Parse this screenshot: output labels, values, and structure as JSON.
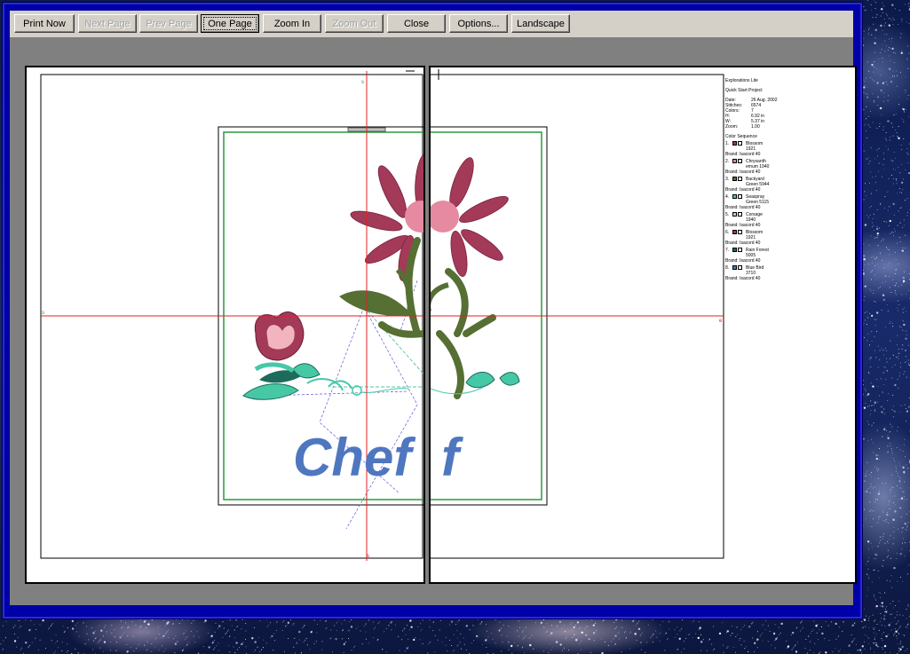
{
  "toolbar": {
    "buttons": [
      {
        "label": "Print Now",
        "enabled": true
      },
      {
        "label": "Next Page",
        "enabled": false
      },
      {
        "label": "Prev Page",
        "enabled": false
      },
      {
        "label": "One Page",
        "enabled": true,
        "active": true
      },
      {
        "label": "Zoom In",
        "enabled": true
      },
      {
        "label": "Zoom Out",
        "enabled": false
      },
      {
        "label": "Close",
        "enabled": true
      },
      {
        "label": "Options...",
        "enabled": true
      },
      {
        "label": "Landscape",
        "enabled": true
      }
    ]
  },
  "design": {
    "text": "Chef",
    "hidden_letter": "f",
    "crosshair_labels": {
      "top": "s",
      "left": "s",
      "right": "e",
      "bottom": "s"
    }
  },
  "info": {
    "app": "Explorations Lite",
    "project": "Quick Start Project",
    "fields": [
      {
        "label": "Date:",
        "value": "26 Aug. 2002"
      },
      {
        "label": "Stitches:",
        "value": "6574"
      },
      {
        "label": "Colors:",
        "value": "7"
      },
      {
        "label": "H:",
        "value": "6.92 in"
      },
      {
        "label": "W:",
        "value": "5.37 in"
      },
      {
        "label": "Zoom:",
        "value": "1.00"
      }
    ],
    "sequence_title": "Color Sequence",
    "sequence": [
      {
        "num": "1.",
        "name": "Blossom",
        "code": "1921",
        "brand": "Brand: Isacord 40",
        "color": "#a33a58"
      },
      {
        "num": "2.",
        "name": "Chrysanth",
        "code": "emum 1940",
        "brand": "Brand: Isacord 40",
        "color": "#e58aa0"
      },
      {
        "num": "3.",
        "name": "Backyard",
        "code": "Green 5944",
        "brand": "Brand: Isacord 40",
        "color": "#566f33"
      },
      {
        "num": "4.",
        "name": "Seaspray",
        "code": "Green 5115",
        "brand": "Brand: Isacord 40",
        "color": "#46c8a6"
      },
      {
        "num": "5.",
        "name": "Corsage",
        "code": "1940",
        "brand": "Brand: Isacord 40",
        "color": "#f2b5c0"
      },
      {
        "num": "6.",
        "name": "Blossom",
        "code": "1921",
        "brand": "Brand: Isacord 40",
        "color": "#a33a58"
      },
      {
        "num": "7.",
        "name": "Rain Forest",
        "code": "5005",
        "brand": "Brand: Isacord 40",
        "color": "#1d6b5a"
      },
      {
        "num": "8.",
        "name": "Blue Bird",
        "code": "3710",
        "brand": "Brand: Isacord 40",
        "color": "#4f77c0"
      }
    ]
  }
}
